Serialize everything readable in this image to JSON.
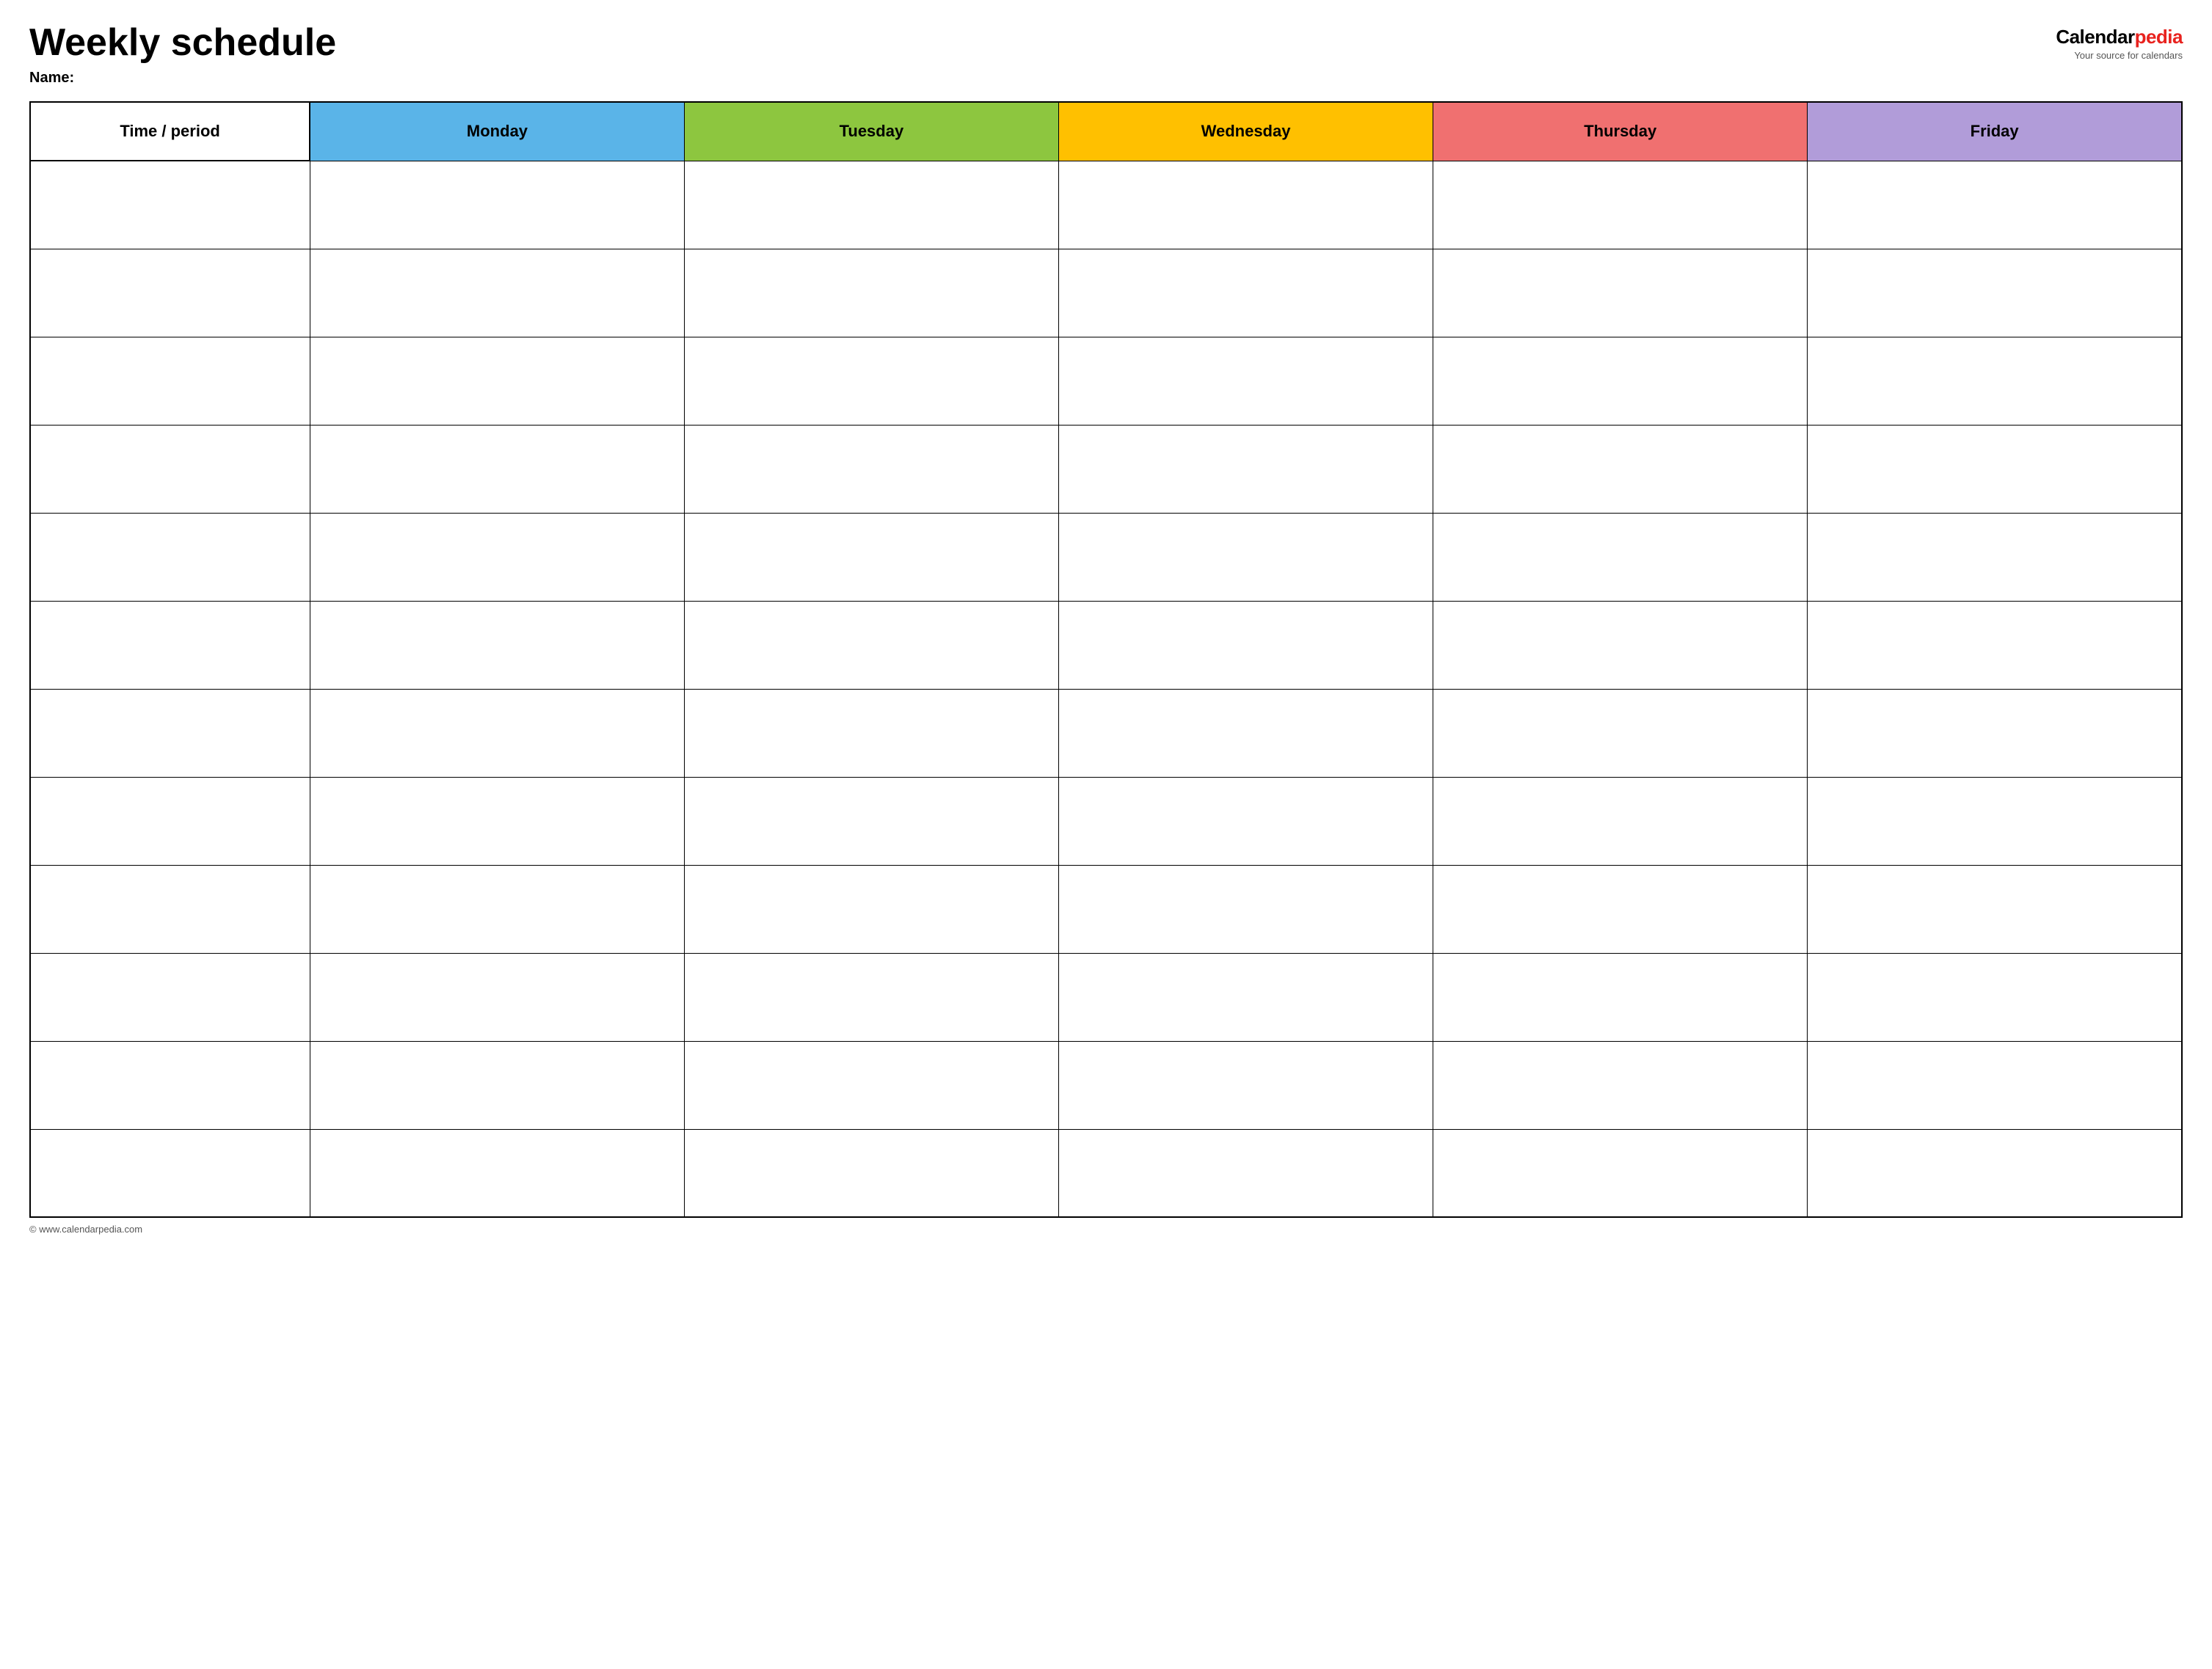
{
  "header": {
    "title": "Weekly schedule",
    "name_label": "Name:",
    "logo_calendar": "Calendar",
    "logo_pedia": "pedia",
    "logo_tagline": "Your source for calendars"
  },
  "table": {
    "columns": [
      {
        "label": "Time / period",
        "key": "time",
        "class": "col-time"
      },
      {
        "label": "Monday",
        "key": "monday",
        "class": "col-monday col-day"
      },
      {
        "label": "Tuesday",
        "key": "tuesday",
        "class": "col-tuesday col-day"
      },
      {
        "label": "Wednesday",
        "key": "wednesday",
        "class": "col-wednesday col-day"
      },
      {
        "label": "Thursday",
        "key": "thursday",
        "class": "col-thursday col-day"
      },
      {
        "label": "Friday",
        "key": "friday",
        "class": "col-friday col-day"
      }
    ],
    "row_count": 12
  },
  "footer": {
    "text": "© www.calendarpedia.com"
  }
}
